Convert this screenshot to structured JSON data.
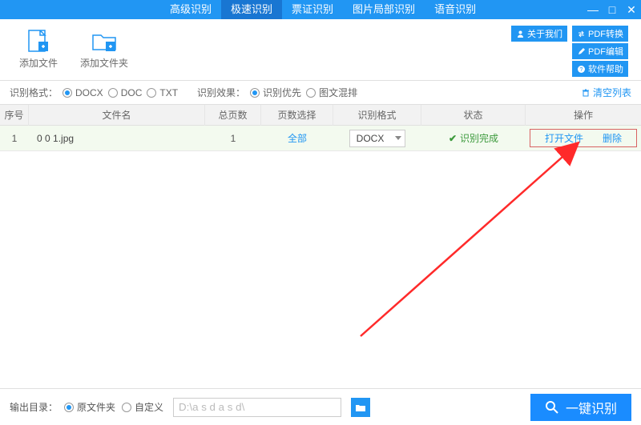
{
  "tabs": [
    "高级识别",
    "极速识别",
    "票证识别",
    "图片局部识别",
    "语音识别"
  ],
  "active_tab": 1,
  "window_buttons": {
    "min": "—",
    "max": "□",
    "close": "✕"
  },
  "toolbar": {
    "add_file": "添加文件",
    "add_folder": "添加文件夹"
  },
  "right_links": {
    "about": "关于我们",
    "pdf_convert": "PDF转换",
    "pdf_edit": "PDF编辑",
    "help": "软件帮助"
  },
  "options": {
    "format_label": "识别格式：",
    "formats": [
      "DOCX",
      "DOC",
      "TXT"
    ],
    "format_selected": "DOCX",
    "effect_label": "识别效果：",
    "effects": [
      "识别优先",
      "图文混排"
    ],
    "effect_selected": "识别优先",
    "clear": "清空列表"
  },
  "table": {
    "headers": {
      "seq": "序号",
      "fname": "文件名",
      "pages": "总页数",
      "pgsel": "页数选择",
      "fmt": "识别格式",
      "status": "状态",
      "ops": "操作"
    },
    "rows": [
      {
        "seq": "1",
        "fname": "0 0 1.jpg",
        "pages": "1",
        "pgsel": "全部",
        "fmt": "DOCX",
        "status": "识别完成",
        "open": "打开文件",
        "delete": "删除"
      }
    ]
  },
  "footer": {
    "output_label": "输出目录：",
    "opts": [
      "原文件夹",
      "自定义"
    ],
    "opt_selected": "原文件夹",
    "path": "D:\\a s d a s d\\",
    "recognize": "一键识别"
  }
}
